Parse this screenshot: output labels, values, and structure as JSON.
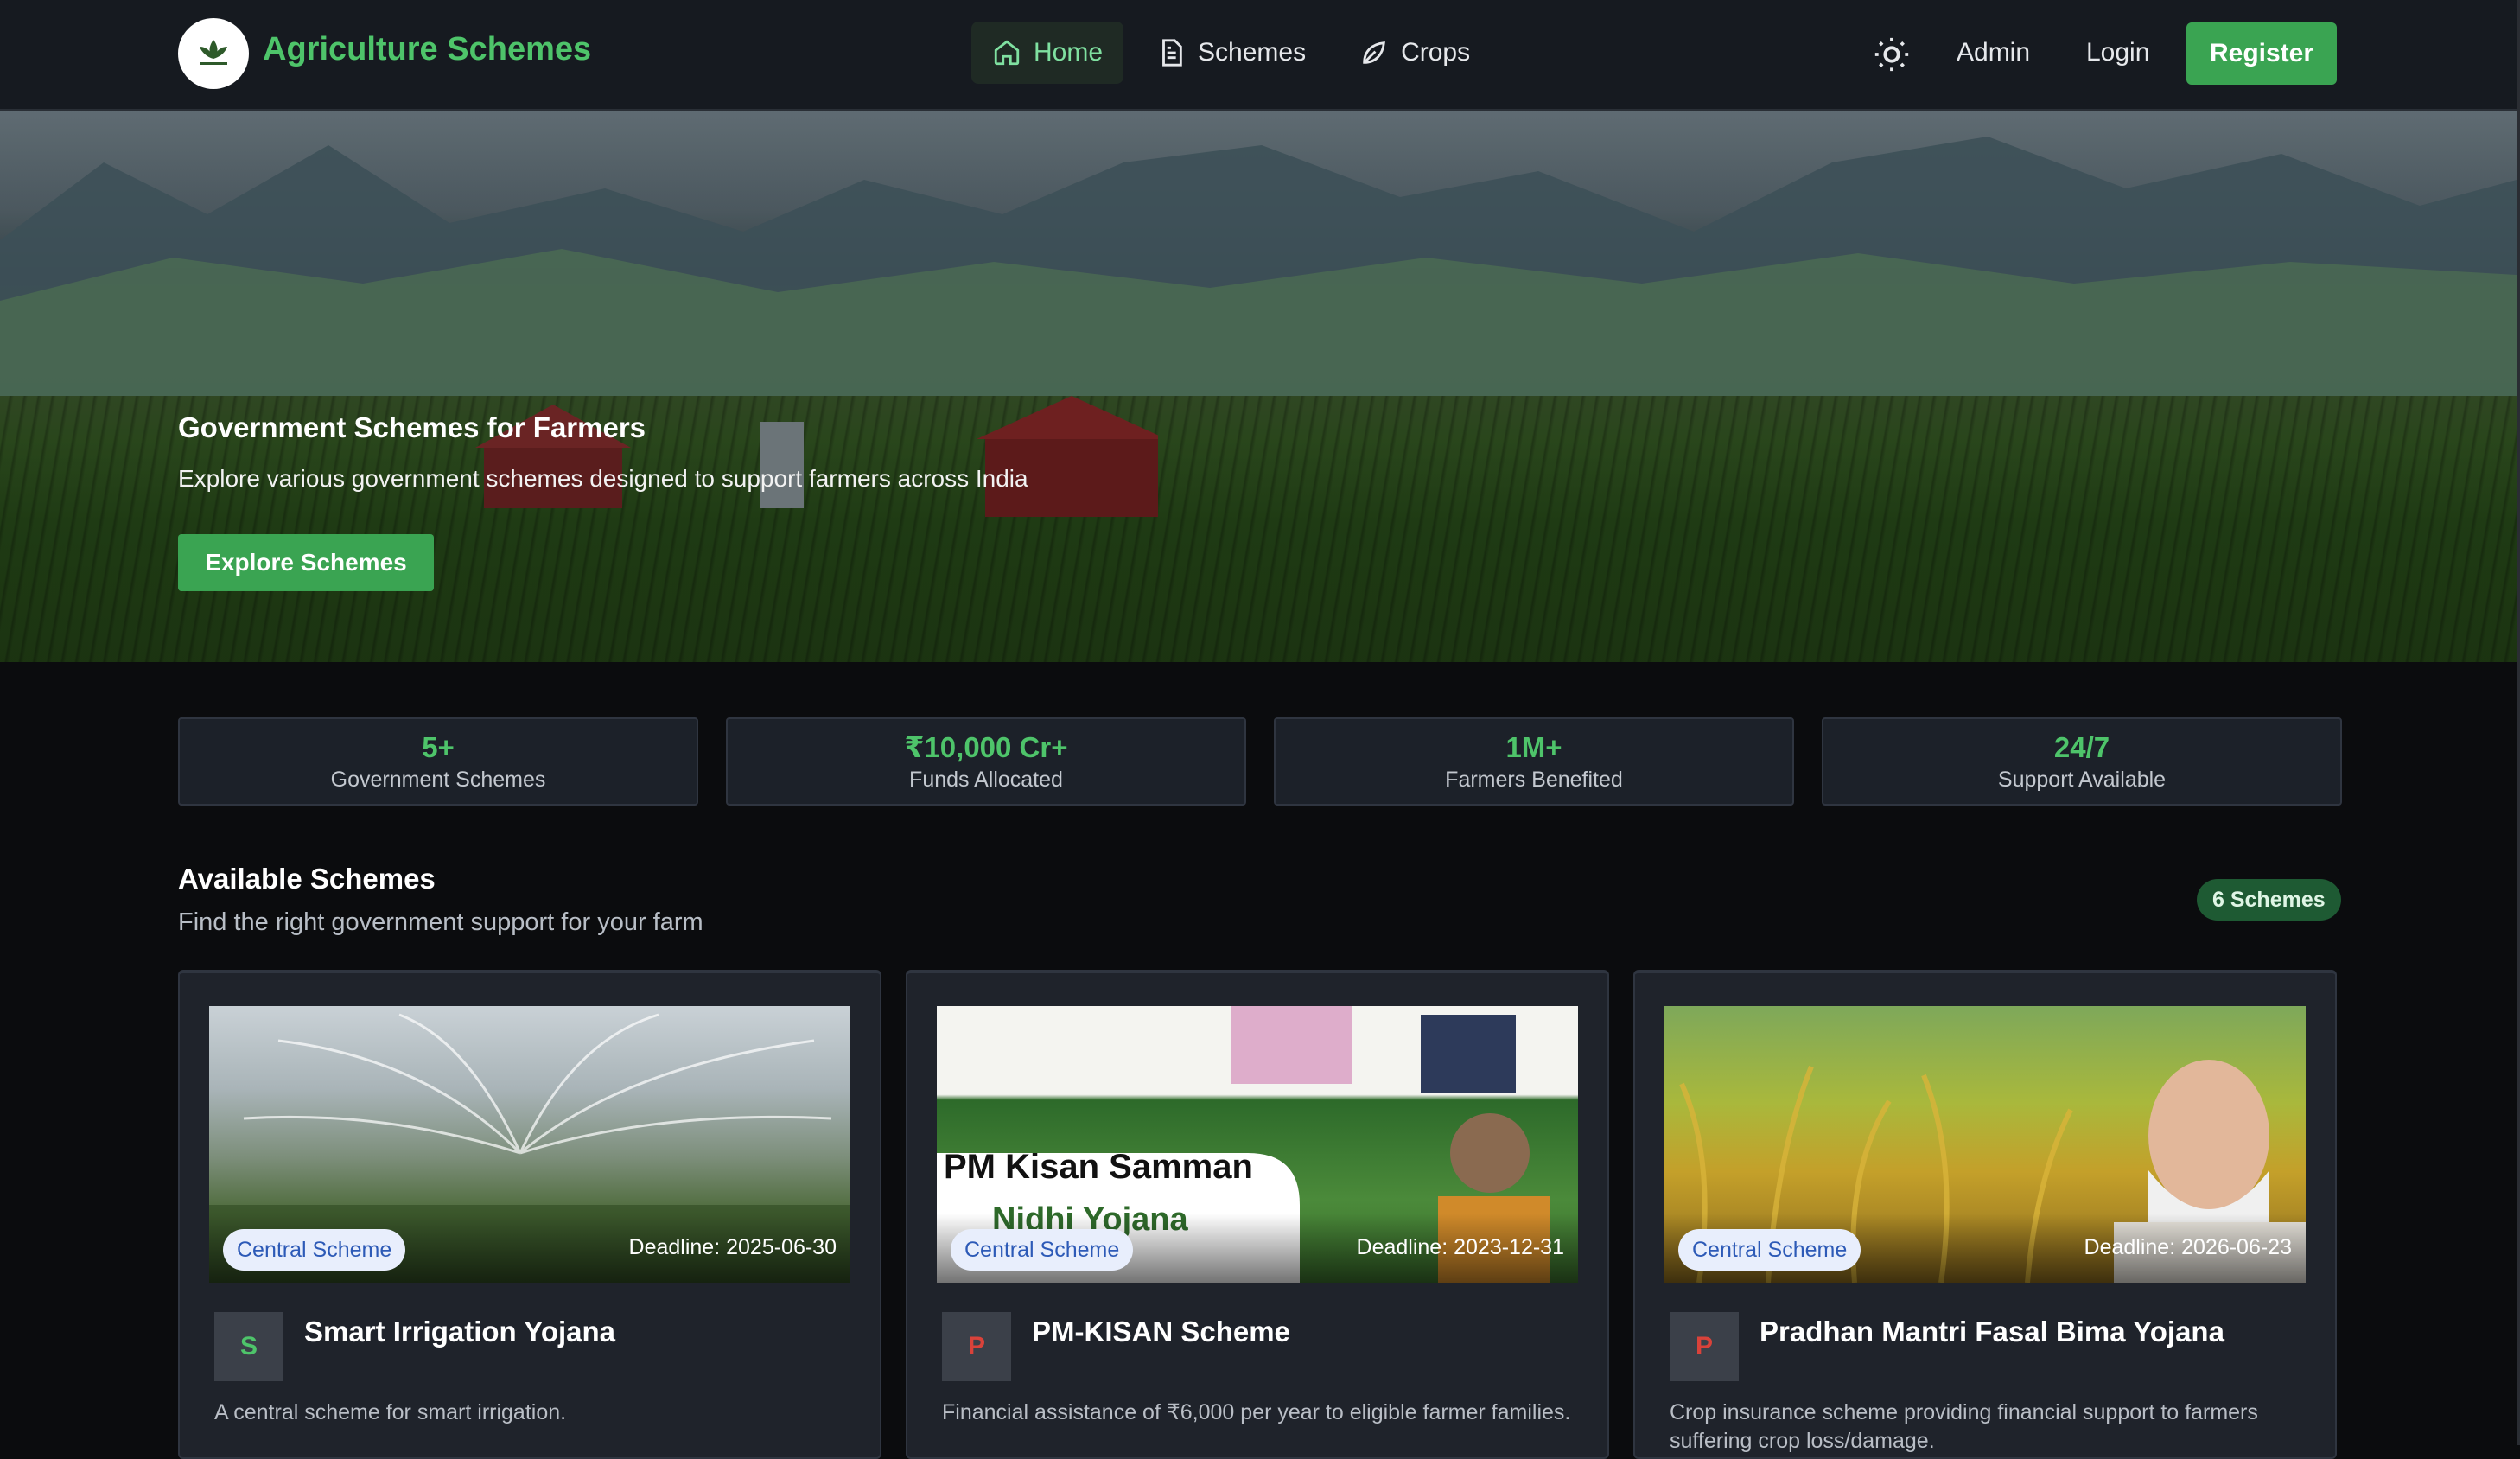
{
  "nav": {
    "brand": "Agriculture Schemes",
    "items": [
      {
        "label": "Home",
        "icon": "home-icon",
        "active": true
      },
      {
        "label": "Schemes",
        "icon": "document-icon",
        "active": false
      },
      {
        "label": "Crops",
        "icon": "leaf-icon",
        "active": false
      }
    ],
    "admin": "Admin",
    "login": "Login",
    "register": "Register"
  },
  "hero": {
    "title": "Government Schemes for Farmers",
    "subtitle": "Explore various government schemes designed to support farmers across India",
    "button": "Explore Schemes"
  },
  "stats": [
    {
      "value": "5+",
      "label": "Government Schemes"
    },
    {
      "value": "₹10,000 Cr+",
      "label": "Funds Allocated"
    },
    {
      "value": "1M+",
      "label": "Farmers Benefited"
    },
    {
      "value": "24/7",
      "label": "Support Available"
    }
  ],
  "section": {
    "title": "Available Schemes",
    "subtitle": "Find the right government support for your farm",
    "count": "6 Schemes"
  },
  "cards": [
    {
      "tag": "Central Scheme",
      "deadline": "Deadline: 2025-06-30",
      "initial": "S",
      "title": "Smart Irrigation Yojana",
      "description": "A central scheme for smart irrigation.",
      "initial_color": "#4ec46a"
    },
    {
      "tag": "Central Scheme",
      "deadline": "Deadline: 2023-12-31",
      "initial": "P",
      "title": "PM-KISAN Scheme",
      "description": "Financial assistance of ₹6,000 per year to eligible farmer families.",
      "initial_color": "#d9423a",
      "image_text": "PM Kisan Samman",
      "image_text2": "Nidhi Yojana"
    },
    {
      "tag": "Central Scheme",
      "deadline": "Deadline: 2026-06-23",
      "initial": "P",
      "title": "Pradhan Mantri Fasal Bima Yojana",
      "description": "Crop insurance scheme providing financial support to farmers suffering crop loss/damage.",
      "initial_color": "#d9423a"
    }
  ],
  "colors": {
    "accent": "#4ec46a",
    "button": "#3aa452",
    "background": "#0b0c0e",
    "card": "#1f232b"
  }
}
